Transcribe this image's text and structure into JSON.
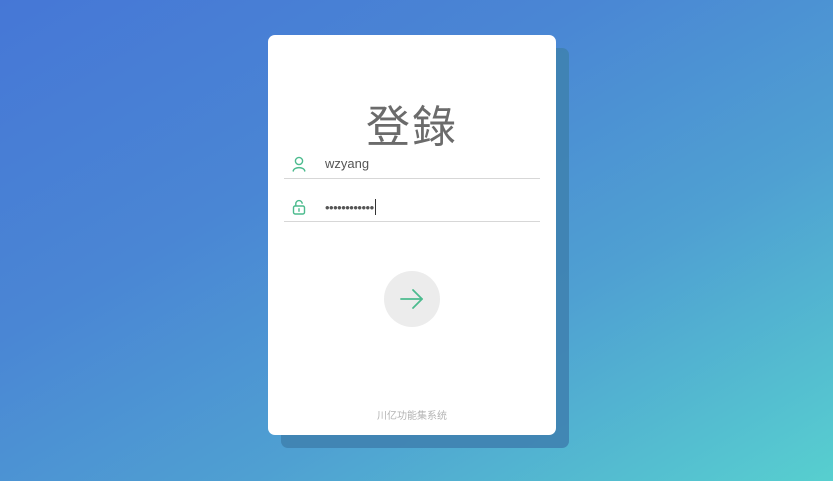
{
  "login": {
    "title": "登錄",
    "username_value": "wzyang",
    "password_value": "••••••••••••",
    "footer_text": "川亿功能集系统"
  },
  "icons": {
    "username": "user-icon",
    "password": "lock-icon",
    "submit": "arrow-right-icon"
  },
  "colors": {
    "accent": "#4cbb8e",
    "background_start": "#4677d6",
    "background_end": "#57cfcf"
  }
}
